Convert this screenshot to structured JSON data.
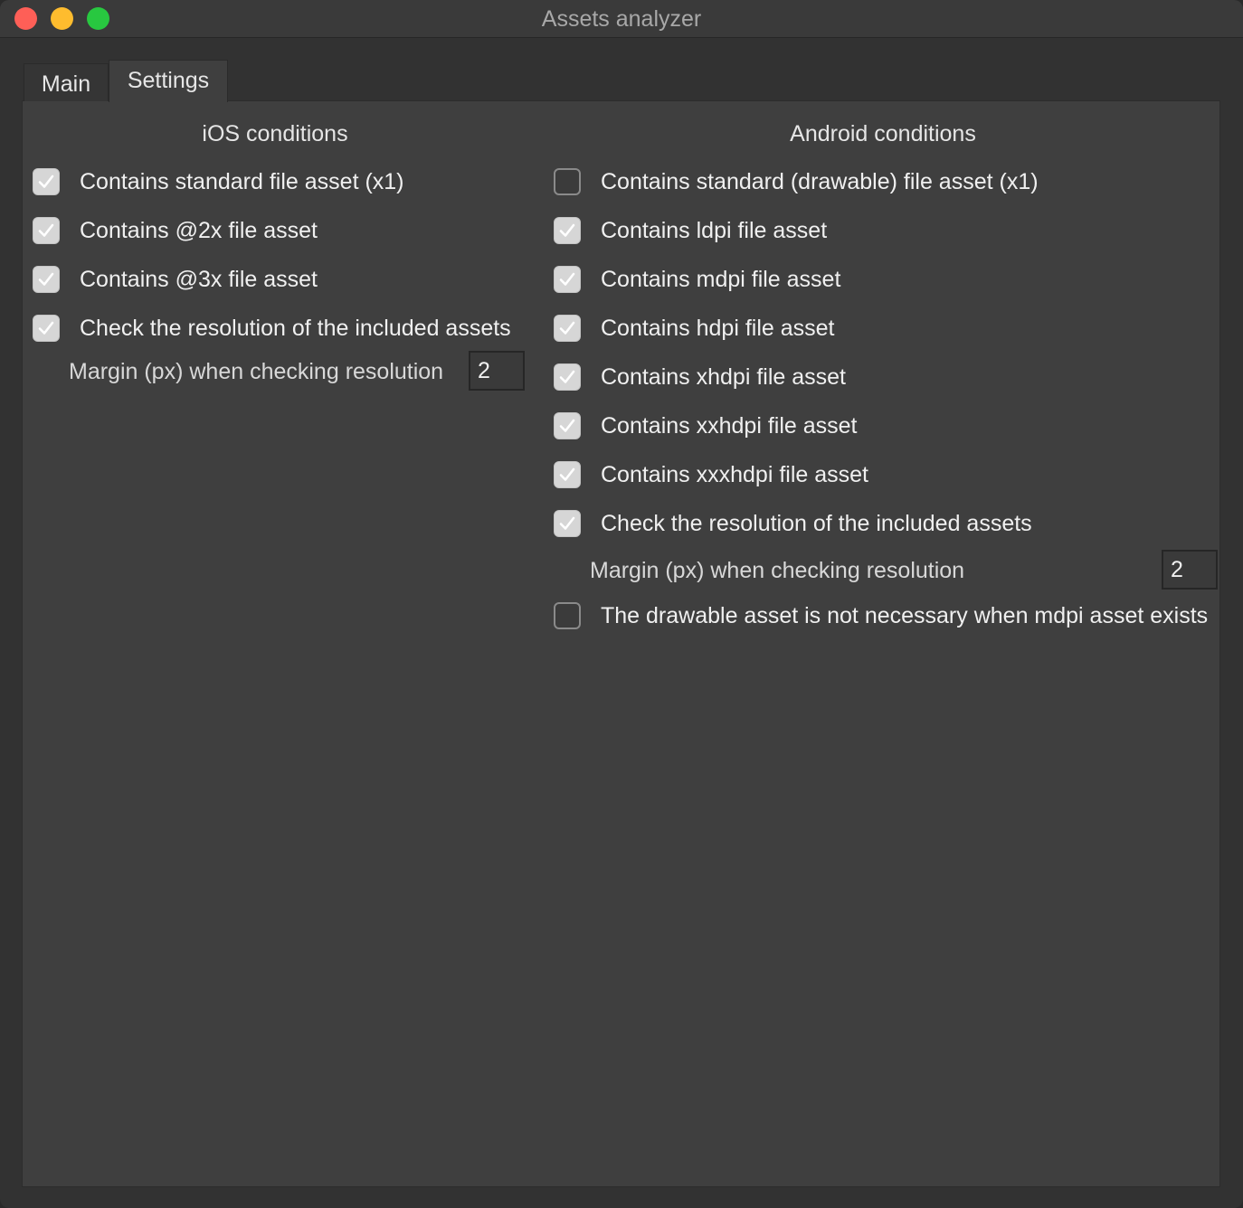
{
  "window": {
    "title": "Assets analyzer"
  },
  "tabs": [
    {
      "label": "Main"
    },
    {
      "label": "Settings"
    }
  ],
  "ios": {
    "title": "iOS conditions",
    "options": [
      {
        "label": "Contains standard file asset (x1)",
        "checked": true
      },
      {
        "label": "Contains @2x file asset",
        "checked": true
      },
      {
        "label": "Contains @3x file asset",
        "checked": true
      },
      {
        "label": "Check the resolution of the included assets",
        "checked": true
      }
    ],
    "margin_label": "Margin (px) when checking resolution",
    "margin_value": "2"
  },
  "android": {
    "title": "Android conditions",
    "options": [
      {
        "label": "Contains standard (drawable) file asset (x1)",
        "checked": false
      },
      {
        "label": "Contains ldpi file asset",
        "checked": true
      },
      {
        "label": "Contains mdpi file asset",
        "checked": true
      },
      {
        "label": "Contains hdpi file asset",
        "checked": true
      },
      {
        "label": "Contains xhdpi file asset",
        "checked": true
      },
      {
        "label": "Contains xxhdpi file asset",
        "checked": true
      },
      {
        "label": "Contains xxxhdpi file asset",
        "checked": true
      },
      {
        "label": "Check the resolution of the included assets",
        "checked": true
      }
    ],
    "margin_label": "Margin (px) when checking resolution",
    "margin_value": "2",
    "extra_option": {
      "label": "The drawable asset is not necessary when mdpi asset exists",
      "checked": false
    }
  }
}
